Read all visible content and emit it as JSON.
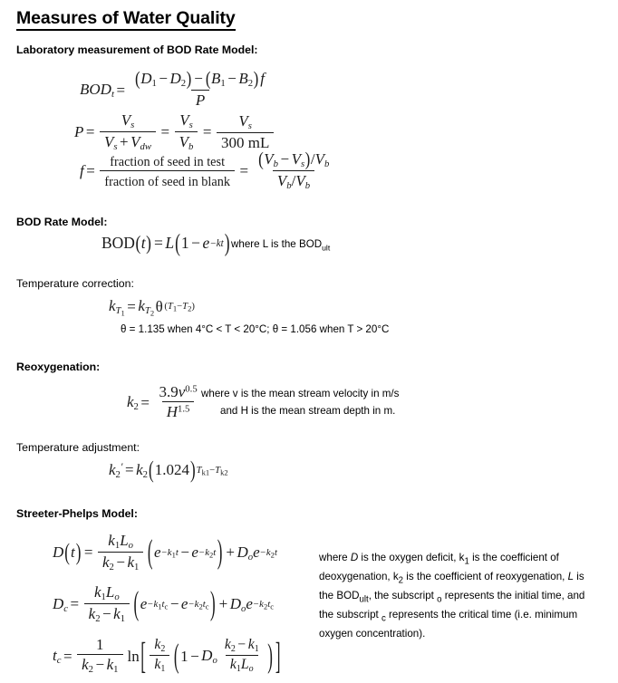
{
  "document": {
    "title": "Measures of Water Quality"
  },
  "sections": [
    {
      "id": "lab-bod",
      "heading": "Laboratory measurement of BOD Rate Model:"
    },
    {
      "id": "bod-rate",
      "heading": "BOD Rate Model:",
      "note": "where L is the BOD"
    },
    {
      "id": "temp-correction",
      "heading": "Temperature correction:",
      "note": "θ = 1.135 when 4°C < T < 20°C; θ = 1.056 when T > 20°C"
    },
    {
      "id": "reoxygenation",
      "heading": "Reoxygenation:",
      "note_line1": "where v is the mean stream velocity in m/s",
      "note_line2": "and H is the mean stream depth in m."
    },
    {
      "id": "temp-adjustment",
      "heading": "Temperature adjustment:"
    },
    {
      "id": "streeter-phelps",
      "heading": "Streeter-Phelps Model:"
    }
  ],
  "equations": {
    "bod_t": {
      "lhs": "BOD",
      "lhs_sub": "t",
      "numerator": "(D₁ − D₂) − (B₁ − B₂) f",
      "denominator": "P"
    },
    "p_dilution": {
      "lhs": "P",
      "term1_num": "Vₛ",
      "term1_den": "Vₛ + Vₑᵥᵥ",
      "term2_num": "Vₛ",
      "term2_den": "V₇",
      "term3_num": "Vₛ",
      "term3_den": "300 mL",
      "volume_blank_label": "300 mL"
    },
    "f_seed": {
      "lhs": "f",
      "num_text": "fraction of seed in test",
      "den_text": "fraction of seed in blank",
      "right_num": "(V₇ − Vₛ)/V₇",
      "right_den": "V₇/V₇"
    },
    "bod_t_model": {
      "text": "BOD(t) = L(1 − e⁻ᵏᵗ)",
      "subscript_ult": "ult"
    },
    "temp_correction": {
      "text": "kₜ₁ = kₜ₂ θ^(T₁ − T₂)",
      "theta_value_cold": "1.135",
      "theta_range_cold": "4°C < T < 20°C",
      "theta_value_warm": "1.056",
      "theta_range_warm": "T > 20°C"
    },
    "reoxygenation": {
      "lhs": "k₂",
      "coefficient": "3.9",
      "velocity_symbol": "v",
      "velocity_exponent": "0.5",
      "depth_symbol": "H",
      "depth_exponent": "1.5"
    },
    "temp_adjustment": {
      "text": "k₂' = k₂(1.024)^(T₁ − T₂)",
      "base": "1.024"
    },
    "deficit_t": {
      "lhs": "D(t)"
    },
    "deficit_c": {
      "lhs": "Dᴄ"
    },
    "time_critical": {
      "lhs": "tᴄ"
    }
  },
  "streeter_phelps_description": {
    "line1_a": "where ",
    "line1_var": "D",
    "line1_b": " is the oxygen deficit, k",
    "line1_sub1": "1",
    "line1_c": " is the coefficient of",
    "line2_a": "deoxygenation, k",
    "line2_sub": "2",
    "line2_b": " is the coefficient of reoxygenation, ",
    "line2_var": "L",
    "line2_c": " is the",
    "line3_a": "BOD",
    "line3_sub": "ult",
    "line3_b": ", the subscript ",
    "line3_sub2": "o",
    "line3_c": " represents the initial time, and the",
    "line4_a": "subscript ",
    "line4_sub": "c",
    "line4_b": " represents the critical time (i.e. minimum oxygen",
    "line5": "concentration)."
  },
  "colors": {
    "text": "#000000",
    "math": "#1a1a1a",
    "background": "#ffffff"
  }
}
